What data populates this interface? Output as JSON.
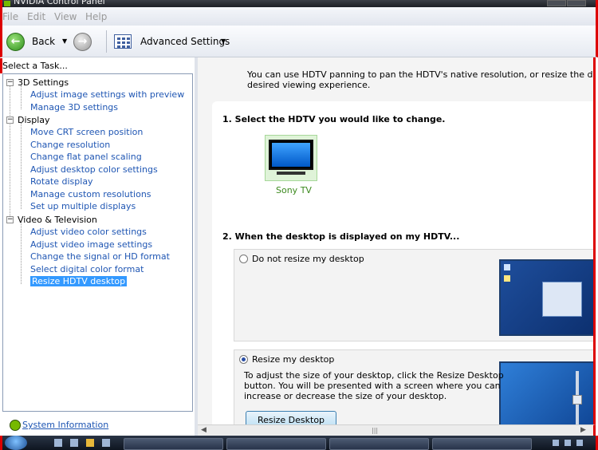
{
  "window": {
    "title": "NVIDIA Control Panel"
  },
  "menu": [
    "File",
    "Edit",
    "View",
    "Help"
  ],
  "toolbar": {
    "back_label": "Back",
    "advanced_label": "Advanced Settings"
  },
  "left": {
    "header": "Select a Task...",
    "tree": [
      {
        "label": "3D Settings",
        "items": [
          "Adjust image settings with preview",
          "Manage 3D settings"
        ]
      },
      {
        "label": "Display",
        "items": [
          "Move CRT screen position",
          "Change resolution",
          "Change flat panel scaling",
          "Adjust desktop color settings",
          "Rotate display",
          "Manage custom resolutions",
          "Set up multiple displays"
        ]
      },
      {
        "label": "Video & Television",
        "items": [
          "Adjust video color settings",
          "Adjust video image settings",
          "Change the signal or HD format",
          "Select digital color format",
          "Resize HDTV desktop"
        ]
      }
    ],
    "selected": "Resize HDTV desktop",
    "system_info": "System Information"
  },
  "right": {
    "intro_line1": "You can use HDTV panning to pan the HDTV's native resolution, or resize the desktop, to achie",
    "intro_line2": "desired viewing experience.",
    "step1": "1. Select the HDTV you would like to change.",
    "tv_name": "Sony TV",
    "step2": "2. When the desktop is displayed on my HDTV...",
    "option1": "Do not resize my desktop",
    "option2": "Resize my desktop",
    "selected_option": "Resize my desktop",
    "desc_line1": "To adjust the size of your desktop, click the Resize Desktop",
    "desc_line2": "button.  You will be presented with a screen where you can",
    "desc_line3": "increase or decrease the size of your desktop.",
    "resize_button": "Resize Desktop"
  },
  "colors": {
    "accent_green": "#76b900",
    "link_blue": "#1f56b3",
    "selection": "#3399ff"
  }
}
